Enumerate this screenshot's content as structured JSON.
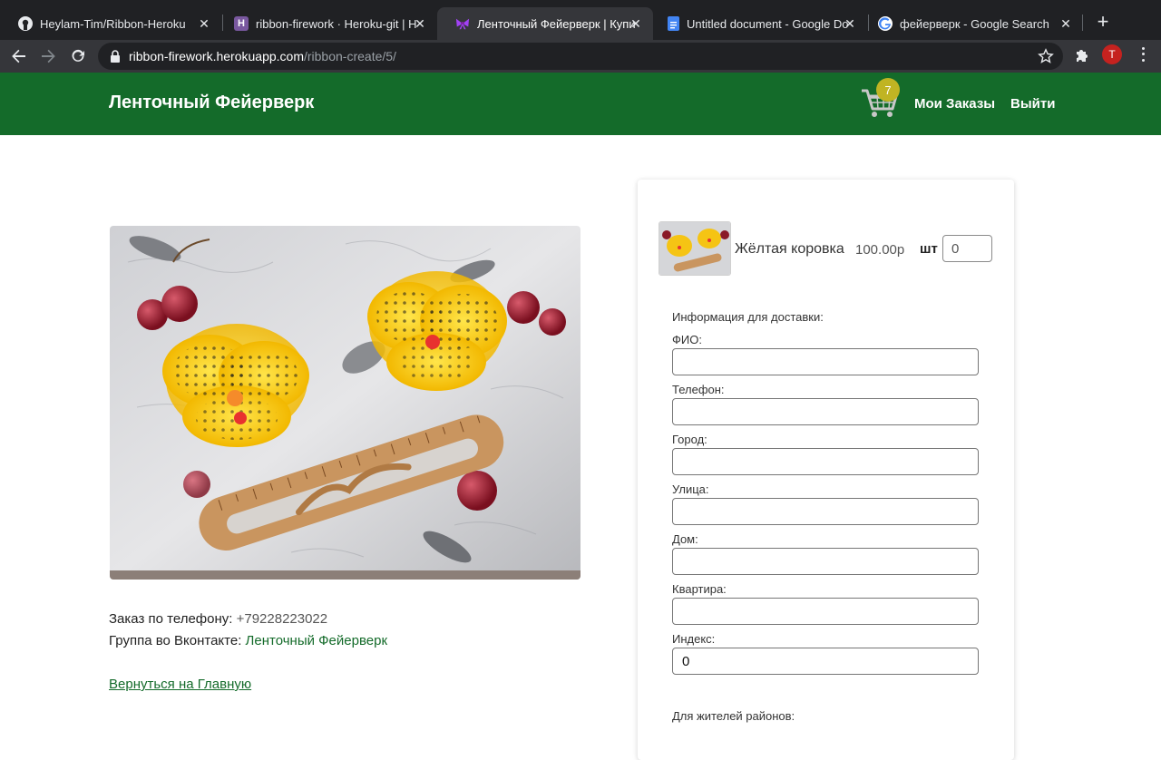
{
  "browser": {
    "tabs": [
      {
        "title": "Heylam-Tim/Ribbon-Heroku",
        "icon": "github-icon"
      },
      {
        "title": "ribbon-firework · Heroku-git | H",
        "icon": "heroku-icon"
      },
      {
        "title": "Ленточный Фейерверк | Купи",
        "icon": "ribbon-bow-icon",
        "active": true
      },
      {
        "title": "Untitled document - Google Do",
        "icon": "google-docs-icon"
      },
      {
        "title": "фейерверк - Google Search",
        "icon": "google-icon"
      }
    ],
    "url_host": "ribbon-firework.herokuapp.com",
    "url_path": "/ribbon-create/5/",
    "profile_initial": "T"
  },
  "header": {
    "brand": "Ленточный Фейерверк",
    "cart_count": "7",
    "nav": {
      "orders": "Мои Заказы",
      "logout": "Выйти"
    },
    "colors": {
      "header_bg": "#146b2a",
      "badge": "#c0b423"
    }
  },
  "product": {
    "photo_icon": "hair-bows-photo",
    "phone_label": "Заказ по телефону:",
    "phone": "+79228223022",
    "vk_label": "Группа во Вконтакте:",
    "vk_link": "Ленточный Фейерверк",
    "back_link": "Вернуться на Главную"
  },
  "order": {
    "product_name": "Жёлтая коровка",
    "price": "100.00р",
    "qty_label": "шт",
    "qty_value": "0",
    "form_title": "Информация для доставки:",
    "fields": [
      {
        "label": "ФИО:",
        "value": ""
      },
      {
        "label": "Телефон:",
        "value": ""
      },
      {
        "label": "Город:",
        "value": ""
      },
      {
        "label": "Улица:",
        "value": ""
      },
      {
        "label": "Дом:",
        "value": ""
      },
      {
        "label": "Квартира:",
        "value": ""
      },
      {
        "label": "Индекс:",
        "value": "0"
      }
    ],
    "district_label": "Для жителей районов:"
  }
}
